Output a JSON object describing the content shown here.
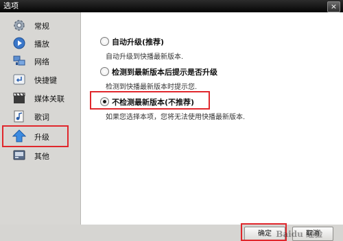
{
  "window": {
    "title": "选项",
    "close_glyph": "×"
  },
  "sidebar": {
    "items": [
      {
        "label": "常规",
        "icon": "gear-icon"
      },
      {
        "label": "播放",
        "icon": "play-icon"
      },
      {
        "label": "网络",
        "icon": "network-icon"
      },
      {
        "label": "快捷键",
        "icon": "shortcut-key-icon"
      },
      {
        "label": "媒体关联",
        "icon": "film-clapper-icon"
      },
      {
        "label": "歌词",
        "icon": "lyrics-note-icon"
      },
      {
        "label": "升级",
        "icon": "up-arrow-icon"
      },
      {
        "label": "其他",
        "icon": "other-panel-icon"
      }
    ],
    "selected": "升级"
  },
  "upgrade": {
    "options": [
      {
        "label": "自动升级(推荐)",
        "desc": "自动升级到快播最新版本.",
        "selected": false
      },
      {
        "label": "检测到最新版本后提示是否升级",
        "desc": "检测到快播最新版本时提示您.",
        "selected": false
      },
      {
        "label": "不检测最新版本(不推荐)",
        "desc": "如果您选择本项，您将无法使用快播最新版本.",
        "selected": true
      }
    ]
  },
  "buttons": {
    "ok": "确定",
    "cancel": "取消"
  },
  "watermark": "Baidu 经验",
  "colors": {
    "highlight": "#e0262b",
    "title_bar": "#111111"
  }
}
